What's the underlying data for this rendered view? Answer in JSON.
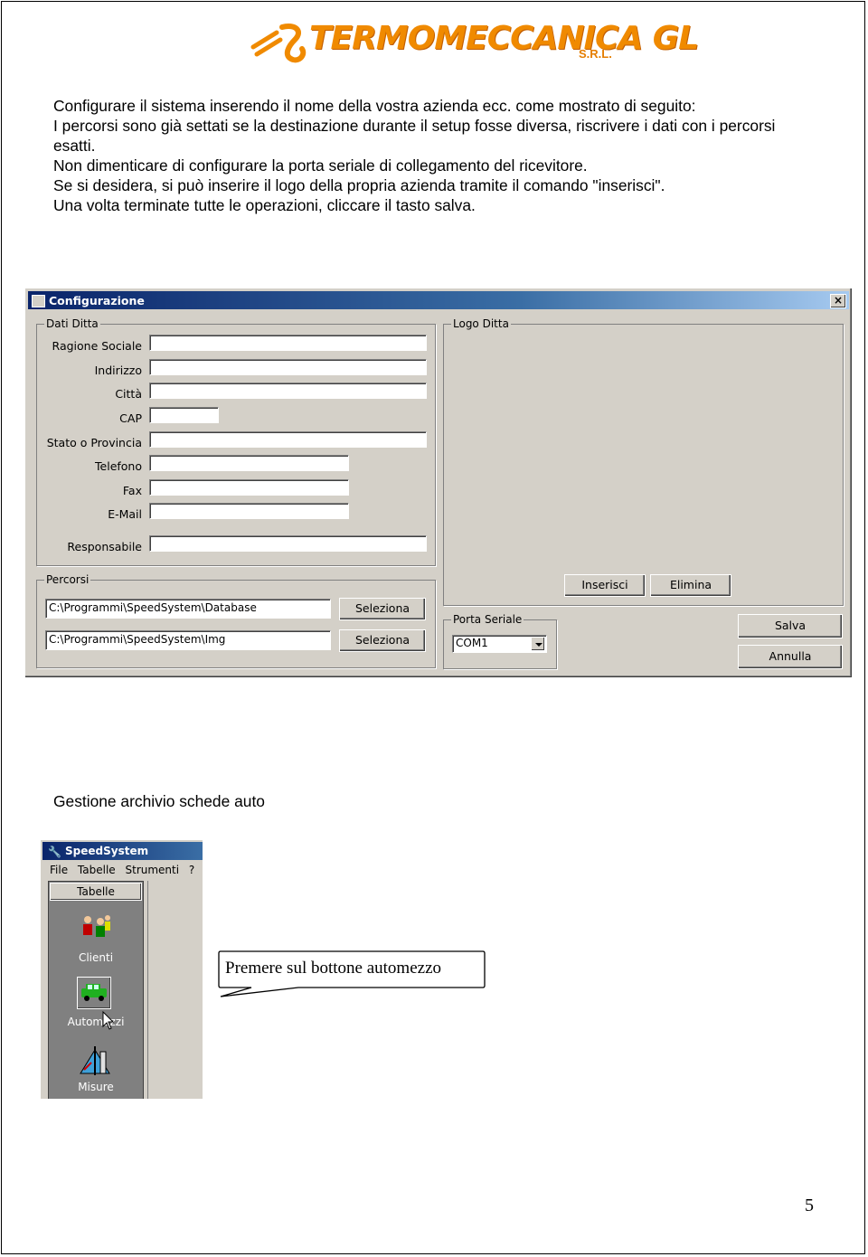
{
  "logo": {
    "name": "TERMOMECCANICA GL",
    "suffix": "S.R.L."
  },
  "intro": [
    "Configurare il sistema inserendo il nome della vostra azienda ecc. come mostrato di seguito:",
    "I percorsi sono già settati se la destinazione durante il setup fosse diversa, riscrivere i dati con i percorsi esatti.",
    "Non dimenticare di configurare la porta seriale di collegamento del ricevitore.",
    "Se si desidera, si può inserire il logo della propria azienda tramite il comando \"inserisci\".",
    "Una volta terminate tutte le operazioni, cliccare il tasto salva."
  ],
  "config_dialog": {
    "title": "Configurazione",
    "close_glyph": "×",
    "dati_ditta": {
      "title": "Dati Ditta",
      "fields": [
        {
          "label": "Ragione Sociale",
          "value": ""
        },
        {
          "label": "Indirizzo",
          "value": ""
        },
        {
          "label": "Città",
          "value": ""
        },
        {
          "label": "CAP",
          "value": ""
        },
        {
          "label": "Stato o Provincia",
          "value": ""
        },
        {
          "label": "Telefono",
          "value": ""
        },
        {
          "label": "Fax",
          "value": ""
        },
        {
          "label": "E-Mail",
          "value": ""
        },
        {
          "label": "Responsabile",
          "value": ""
        }
      ]
    },
    "logo_ditta": {
      "title": "Logo Ditta"
    },
    "percorsi": {
      "title": "Percorsi",
      "paths": [
        {
          "value": "C:\\Programmi\\SpeedSystem\\Database",
          "button": "Seleziona"
        },
        {
          "value": "C:\\Programmi\\SpeedSystem\\Img",
          "button": "Seleziona"
        }
      ]
    },
    "porta_seriale": {
      "title": "Porta Seriale",
      "selected": "COM1"
    },
    "buttons": {
      "inserisci": "Inserisci",
      "elimina": "Elimina",
      "salva": "Salva",
      "annulla": "Annulla"
    }
  },
  "section_title": "Gestione archivio schede auto",
  "speedsystem": {
    "title": "SpeedSystem",
    "menu": [
      "File",
      "Tabelle",
      "Strumenti",
      "?"
    ],
    "panel_tab": "Tabelle",
    "items": [
      "Clienti",
      "Automezzi",
      "Misure"
    ]
  },
  "callout": "Premere sul bottone automezzo",
  "page_number": "5"
}
